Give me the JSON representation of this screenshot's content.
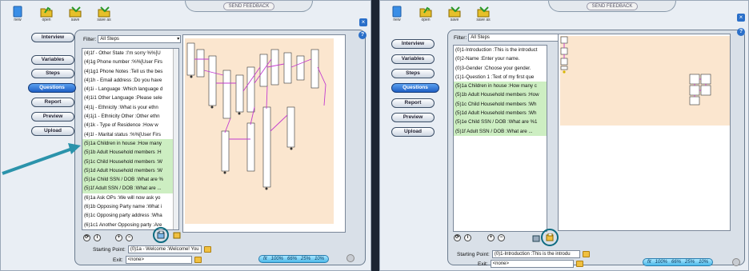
{
  "toolbar_left": [
    {
      "label": "new",
      "icon": "new-file-icon"
    },
    {
      "label": "open",
      "icon": "open-folder-icon"
    },
    {
      "label": "save",
      "icon": "save-icon"
    },
    {
      "label": "save as",
      "icon": "save-as-icon"
    }
  ],
  "toolbar_right": [
    {
      "label": "new",
      "icon": "new-file-icon"
    },
    {
      "label": "open",
      "icon": "open-folder-icon"
    },
    {
      "label": "save",
      "icon": "save-icon"
    },
    {
      "label": "save as",
      "icon": "save-as-icon"
    }
  ],
  "feedback_label": "SEND FEEDBACK",
  "close_symbol": "×",
  "help_symbol": "?",
  "nav": [
    "Interview",
    "Variables",
    "Steps",
    "Questions",
    "Report",
    "Preview",
    "Upload"
  ],
  "nav_active": "Questions",
  "filter_label": "Filter:",
  "filter_value": "All Steps",
  "left_list": [
    {
      "t": "(4)1f - Other State :I'm sorry %%[U",
      "g": false
    },
    {
      "t": "(4)1g Phone number :%%[User Firs",
      "g": false
    },
    {
      "t": "(4)1g1 Phone Notes :Tell us the bes",
      "g": false
    },
    {
      "t": "(4)1h - Email address :Do you have",
      "g": false
    },
    {
      "t": "(4)1i - Language :Which language d",
      "g": false
    },
    {
      "t": "(4)1i1 Other Language :Please sele",
      "g": false
    },
    {
      "t": "(4)1j - Ethnicity :What is your ethn",
      "g": false
    },
    {
      "t": "(4)1j1 - Ethnicity Other :Other ethn",
      "g": false
    },
    {
      "t": "(4)1k - Type of Residence :How w",
      "g": false
    },
    {
      "t": "(4)1l - Marital status :%%[User Firs",
      "g": false
    },
    {
      "t": "(5)1a Children in house :How many",
      "g": true
    },
    {
      "t": "(5)1b Adult Household members :H",
      "g": true
    },
    {
      "t": "(5)1c Child Household members :W",
      "g": true
    },
    {
      "t": "(5)1d Adult  Household members :W",
      "g": true
    },
    {
      "t": "(5)1e Child SSN / DOB :What are %",
      "g": true
    },
    {
      "t": "(5)1f Adult SSN / DOB :What are ...",
      "g": true
    },
    {
      "t": "(6)1a Ask OPs :We will now ask yo",
      "g": false
    },
    {
      "t": "(6)1b Opposing Party name :What i",
      "g": false
    },
    {
      "t": "(6)1c Opposing party address :Wha",
      "g": false
    },
    {
      "t": "(6)1c1 Another Opposing party :Are",
      "g": false
    }
  ],
  "right_list": [
    {
      "t": "(0)1-Introduction :This is the introduct",
      "g": false
    },
    {
      "t": "(0)2-Name :Enter your name.",
      "g": false
    },
    {
      "t": "(0)3-Gender :Choose your gender.",
      "g": false
    },
    {
      "t": "(1)1-Question 1 :Text of my first que",
      "g": false
    },
    {
      "t": "(5)1a Children in house :How many c",
      "g": true
    },
    {
      "t": "(5)1b Adult Household members :How",
      "g": true
    },
    {
      "t": "(5)1c Child Household members :Wh",
      "g": true
    },
    {
      "t": "(5)1d Adult  Household members :Wh",
      "g": true
    },
    {
      "t": "(5)1e Child SSN / DOB :What are %1",
      "g": true
    },
    {
      "t": "(5)1f Adult SSN / DOB :What are ...",
      "g": true
    }
  ],
  "starting_point_label": "Starting Point:",
  "exit_label": "Exit:",
  "left_starting_point": "(0)1a - Welcome :Welcome! You",
  "right_starting_point": "(0)1-Introduction :This is the introdu",
  "exit_value": "<none>",
  "zoom": [
    "fit",
    "100%",
    "66%",
    "25%",
    "10%"
  ],
  "colors": {
    "canvas_bg": "#fbe6cf",
    "green_row": "#cdeec2",
    "arrow": "#2b93ab",
    "link": "#c23bcf",
    "ring": "#0d6b80"
  }
}
